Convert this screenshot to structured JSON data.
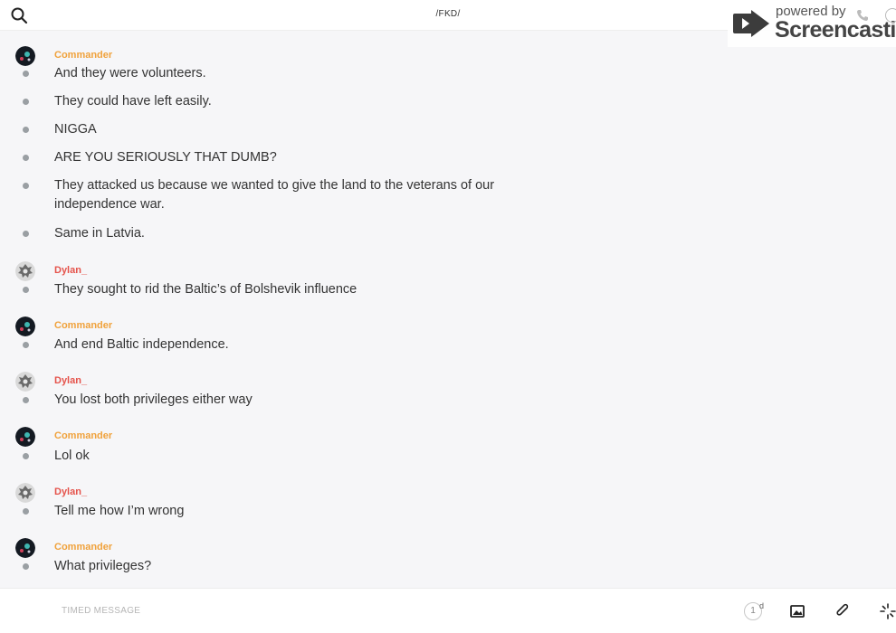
{
  "header": {
    "title": "/FKD/",
    "search_icon": "search-icon"
  },
  "watermark": {
    "powered_by": "powered by",
    "brand": "Screencastify"
  },
  "colors": {
    "commander": "#f0a23c",
    "dylan": "#e5534b",
    "dot": "#9a9fa3"
  },
  "messages": [
    {
      "author": "Commander",
      "text": "And they were volunteers."
    },
    {
      "text": "They could have left easily."
    },
    {
      "text": "NIGGA"
    },
    {
      "text": "ARE YOU SERIOUSLY THAT DUMB?"
    },
    {
      "text": "They attacked us because we wanted to give the land to the veterans of our independence war."
    },
    {
      "text": "Same in Latvia."
    },
    {
      "author": "Dylan_",
      "text": "They sought to rid the Baltic’s of Bolshevik influence"
    },
    {
      "author": "Commander",
      "text": "And end Baltic independence."
    },
    {
      "author": "Dylan_",
      "text": "You lost both privileges either way"
    },
    {
      "author": "Commander",
      "text": "Lol ok"
    },
    {
      "author": "Dylan_",
      "text": "Tell me how I’m wrong"
    },
    {
      "author": "Commander",
      "text": "What privileges?"
    }
  ],
  "composer": {
    "placeholder": "TIMED MESSAGE",
    "timer_value": "1",
    "timer_unit": "d"
  }
}
